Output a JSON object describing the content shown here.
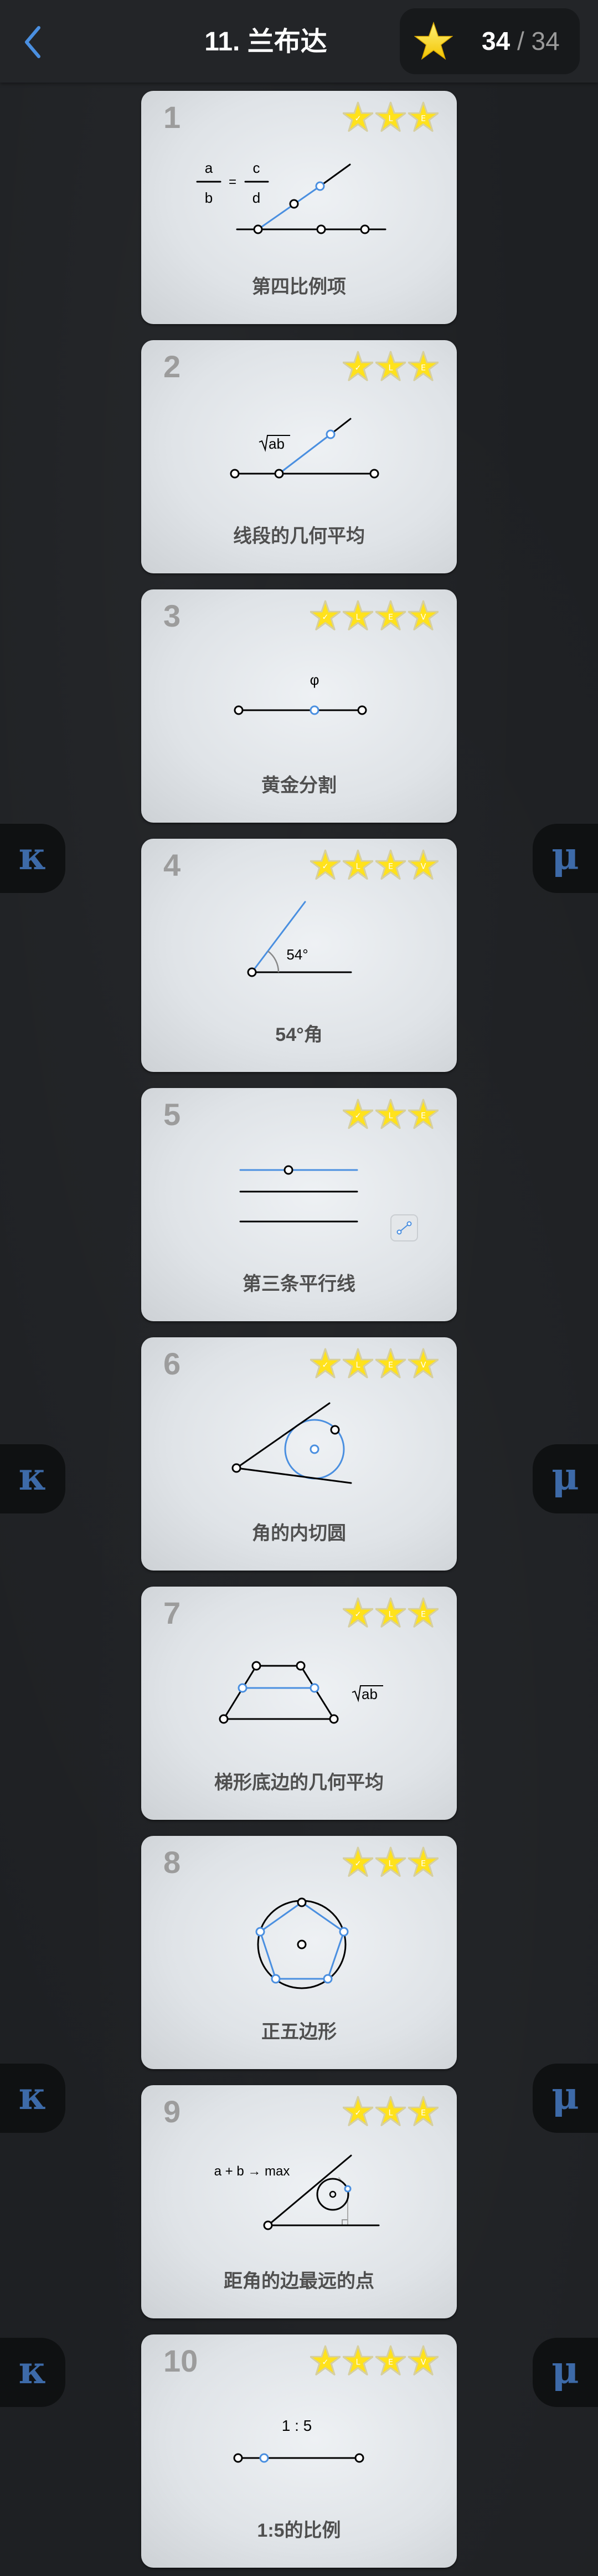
{
  "header": {
    "title": "11. 兰布达",
    "back_icon": "chevron-left-icon",
    "stars_earned": "34",
    "stars_separator": " / ",
    "stars_total": "34"
  },
  "colors": {
    "accent": "#4a8fe0",
    "star": "#f7d417",
    "tab_letter": "#3d6aa8"
  },
  "side_tabs": {
    "left_label": "κ",
    "right_label": "μ"
  },
  "levels": [
    {
      "number": "1",
      "title": "第四比例项",
      "stars": [
        "✓",
        "L",
        "E"
      ],
      "labels": {
        "a": "a",
        "b": "b",
        "c": "c",
        "d": "d",
        "eq": "="
      }
    },
    {
      "number": "2",
      "title": "线段的几何平均",
      "stars": [
        "✓",
        "L",
        "E"
      ],
      "labels": {
        "root": "ab"
      }
    },
    {
      "number": "3",
      "title": "黄金分割",
      "stars": [
        "✓",
        "L",
        "E",
        "V"
      ],
      "labels": {
        "phi": "φ"
      }
    },
    {
      "number": "4",
      "title": "54°角",
      "stars": [
        "✓",
        "L",
        "E",
        "V"
      ],
      "labels": {
        "angle": "54°"
      }
    },
    {
      "number": "5",
      "title": "第三条平行线",
      "stars": [
        "✓",
        "L",
        "E"
      ],
      "labels": {}
    },
    {
      "number": "6",
      "title": "角的内切圆",
      "stars": [
        "✓",
        "L",
        "E",
        "V"
      ],
      "labels": {}
    },
    {
      "number": "7",
      "title": "梯形底边的几何平均",
      "stars": [
        "✓",
        "L",
        "E"
      ],
      "labels": {
        "root": "ab"
      }
    },
    {
      "number": "8",
      "title": "正五边形",
      "stars": [
        "✓",
        "L",
        "E"
      ],
      "labels": {}
    },
    {
      "number": "9",
      "title": "距角的边最远的点",
      "stars": [
        "✓",
        "L",
        "E"
      ],
      "labels": {
        "formula": "a + b → max"
      }
    },
    {
      "number": "10",
      "title": "1:5的比例",
      "stars": [
        "✓",
        "L",
        "E",
        "V"
      ],
      "labels": {
        "ratio": "1 : 5"
      }
    }
  ]
}
